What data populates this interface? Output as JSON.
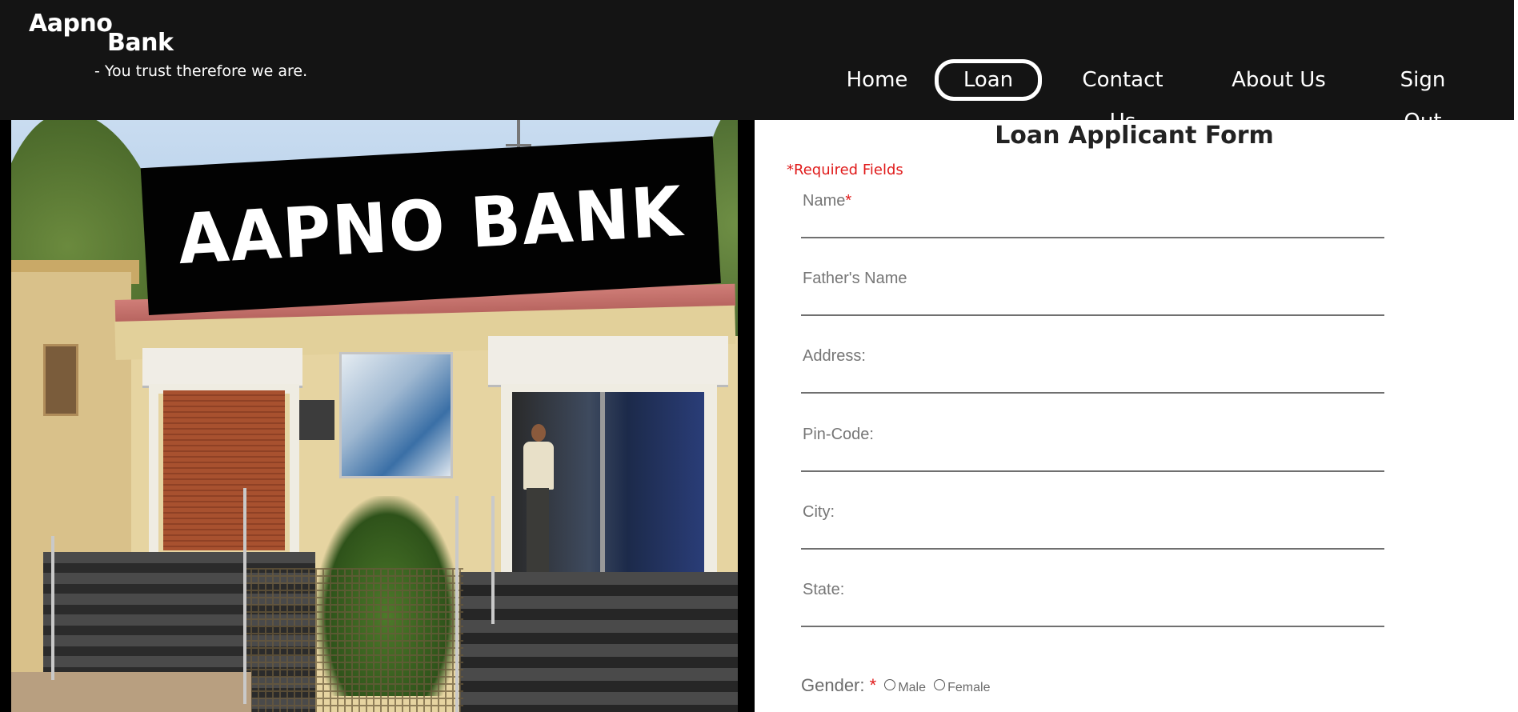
{
  "header": {
    "brand_line1": "Aapno",
    "brand_line2": "Bank",
    "tagline": "- You trust therefore we are."
  },
  "nav": {
    "home": "Home",
    "loan": "Loan",
    "contact": "Contact Us",
    "about": "About Us",
    "sign_out": "Sign Out",
    "active": "Loan"
  },
  "photo": {
    "sign_text": "AAPNO BANK"
  },
  "form": {
    "title": "Loan Applicant Form",
    "required_note": "*Required Fields",
    "fields": [
      {
        "label": "Name",
        "required": "*"
      },
      {
        "label": "Father's Name"
      },
      {
        "label": "Address:"
      },
      {
        "label": "Pin-Code:"
      },
      {
        "label": "City:"
      },
      {
        "label": "State:"
      }
    ],
    "gender": {
      "label": "Gender:",
      "required": "*",
      "options": [
        "Male",
        "Female"
      ]
    }
  },
  "colors": {
    "header_bg": "#141414",
    "required": "#e01a1a",
    "form_bg": "#ffffff"
  }
}
